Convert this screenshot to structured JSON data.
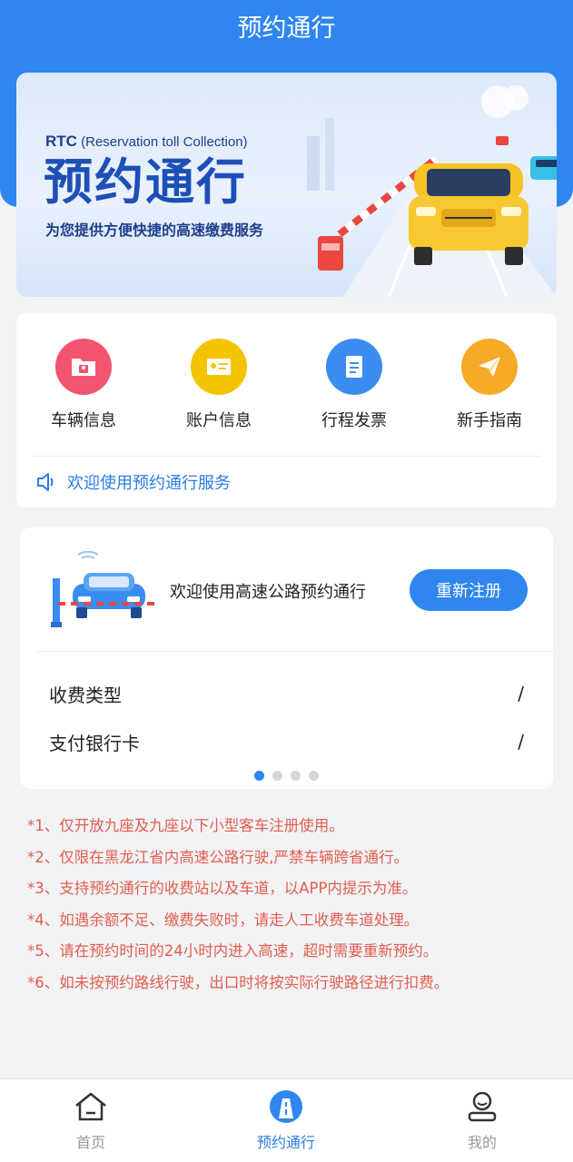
{
  "header": {
    "title": "预约通行"
  },
  "banner": {
    "rtc": "RTC",
    "subtitle": "(Reservation toll Collection)",
    "title": "预约通行",
    "description": "为您提供方便快捷的高速缴费服务"
  },
  "menu": {
    "items": [
      {
        "label": "车辆信息",
        "icon": "vehicle-folder-icon",
        "color": "#f2546f"
      },
      {
        "label": "账户信息",
        "icon": "id-card-icon",
        "color": "#f5c400"
      },
      {
        "label": "行程发票",
        "icon": "invoice-icon",
        "color": "#3b8cf0"
      },
      {
        "label": "新手指南",
        "icon": "paper-plane-icon",
        "color": "#f7a928"
      }
    ],
    "notice": "欢迎使用预约通行服务"
  },
  "registration": {
    "welcome": "欢迎使用高速公路预约通行",
    "button": "重新注册",
    "rows": [
      {
        "label": "收费类型",
        "value": "/"
      },
      {
        "label": "支付银行卡",
        "value": "/"
      }
    ],
    "page_count": 4,
    "active_page": 1
  },
  "rules": [
    "*1、仅开放九座及九座以下小型客车注册使用。",
    "*2、仅限在黑龙江省内高速公路行驶,严禁车辆跨省通行。",
    "*3、支持预约通行的收费站以及车道，以APP内提示为准。",
    "*4、如遇余额不足、缴费失败时，请走人工收费车道处理。",
    "*5、请在预约时间的24小时内进入高速，超时需要重新预约。",
    "*6、如未按预约路线行驶，出口时将按实际行驶路径进行扣费。"
  ],
  "bottom_nav": [
    {
      "label": "首页",
      "icon": "home-icon"
    },
    {
      "label": "预约通行",
      "icon": "road-icon",
      "active": true
    },
    {
      "label": "我的",
      "icon": "user-icon"
    }
  ],
  "colors": {
    "primary": "#2f86ee",
    "rule_text": "#e25d4f",
    "background": "#f2f3f5"
  }
}
